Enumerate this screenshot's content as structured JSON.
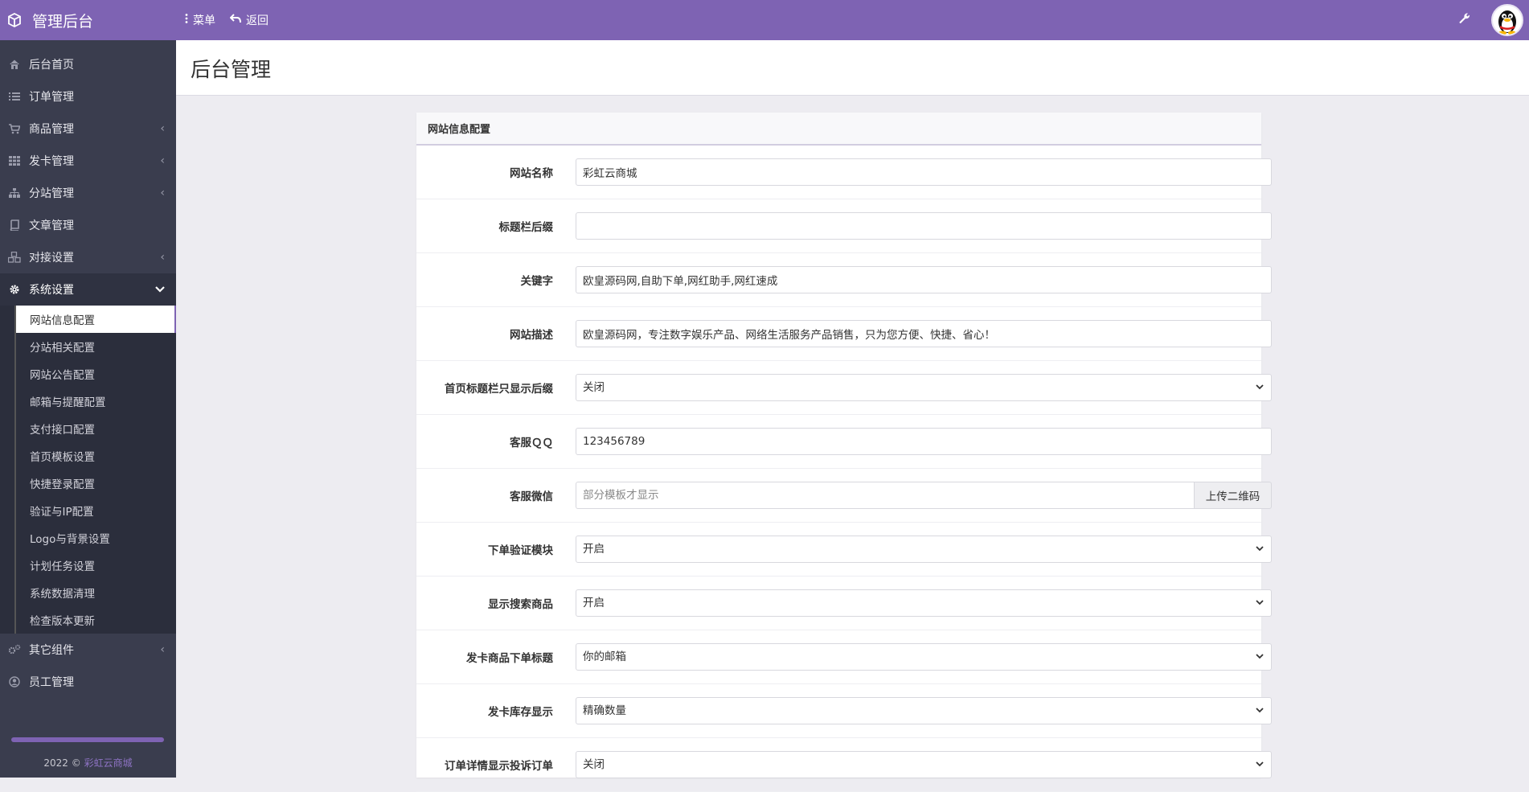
{
  "header": {
    "brand_title": "管理后台",
    "menu_label": "菜单",
    "back_label": "返回"
  },
  "sidebar": {
    "items": [
      {
        "label": "后台首页",
        "icon": "home-icon",
        "has_chevron": false
      },
      {
        "label": "订单管理",
        "icon": "list-icon",
        "has_chevron": false
      },
      {
        "label": "商品管理",
        "icon": "cart-icon",
        "has_chevron": true
      },
      {
        "label": "发卡管理",
        "icon": "grid-icon",
        "has_chevron": true
      },
      {
        "label": "分站管理",
        "icon": "sitemap-icon",
        "has_chevron": true
      },
      {
        "label": "文章管理",
        "icon": "book-icon",
        "has_chevron": false
      },
      {
        "label": "对接设置",
        "icon": "cubes-icon",
        "has_chevron": true
      },
      {
        "label": "系统设置",
        "icon": "gear-icon",
        "has_chevron": true,
        "active": true
      }
    ],
    "subitems": [
      "网站信息配置",
      "分站相关配置",
      "网站公告配置",
      "邮箱与提醒配置",
      "支付接口配置",
      "首页模板设置",
      "快捷登录配置",
      "验证与IP配置",
      "Logo与背景设置",
      "计划任务设置",
      "系统数据清理",
      "检查版本更新"
    ],
    "after_items": [
      {
        "label": "其它组件",
        "icon": "cogs-icon",
        "has_chevron": true
      },
      {
        "label": "员工管理",
        "icon": "user-circle-icon",
        "has_chevron": false
      }
    ],
    "footer_year": "2022 ©",
    "footer_link": "彩虹云商城"
  },
  "page": {
    "title": "后台管理"
  },
  "panel": {
    "title": "网站信息配置",
    "fields": [
      {
        "label": "网站名称",
        "type": "input",
        "value": "彩虹云商城"
      },
      {
        "label": "标题栏后缀",
        "type": "input",
        "value": ""
      },
      {
        "label": "关键字",
        "type": "input",
        "value": "欧皇源码网,自助下单,网红助手,网红速成"
      },
      {
        "label": "网站描述",
        "type": "input",
        "value": "欧皇源码网，专注数字娱乐产品、网络生活服务产品销售，只为您方便、快捷、省心！"
      },
      {
        "label": "首页标题栏只显示后缀",
        "type": "select",
        "value": "关闭"
      },
      {
        "label": "客服ＱＱ",
        "type": "input",
        "value": "123456789"
      },
      {
        "label": "客服微信",
        "type": "input-group",
        "value": "",
        "placeholder": "部分模板才显示",
        "addon": "上传二维码"
      },
      {
        "label": "下单验证模块",
        "type": "select",
        "value": "开启"
      },
      {
        "label": "显示搜索商品",
        "type": "select",
        "value": "开启"
      },
      {
        "label": "发卡商品下单标题",
        "type": "select",
        "value": "你的邮箱"
      },
      {
        "label": "发卡库存显示",
        "type": "select",
        "value": "精确数量"
      },
      {
        "label": "订单详情显示投诉订单",
        "type": "select",
        "value": "关闭"
      }
    ]
  },
  "colors": {
    "accent": "#7e63b3",
    "sidebar_bg": "#3a3d4e",
    "content_bg": "#edecf1"
  }
}
